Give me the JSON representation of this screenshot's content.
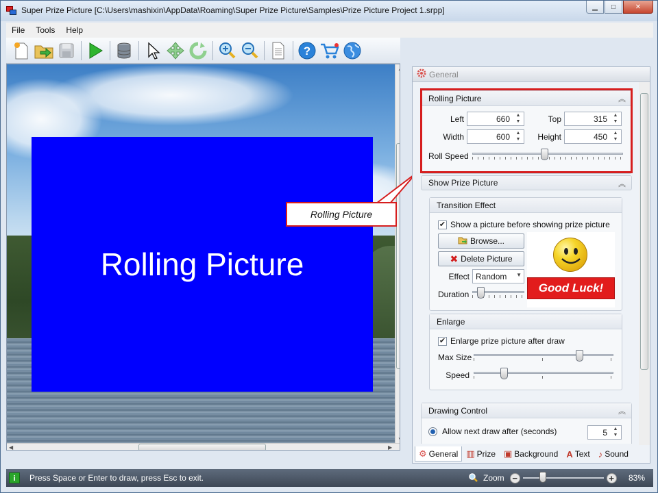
{
  "window": {
    "title": "Super Prize Picture [C:\\Users\\mashixin\\AppData\\Roaming\\Super Prize Picture\\Samples\\Prize Picture Project 1.srpp]",
    "minimize": "▁",
    "maximize": "□",
    "close": "✕"
  },
  "menu": [
    "File",
    "Tools",
    "Help"
  ],
  "toolbar": [
    {
      "name": "new-project-icon"
    },
    {
      "name": "open-folder-icon"
    },
    {
      "name": "save-disk-icon"
    },
    {
      "name": "play-icon"
    },
    {
      "name": "database-icon"
    },
    {
      "name": "pointer-icon"
    },
    {
      "name": "move-icon"
    },
    {
      "name": "rotate-icon"
    },
    {
      "name": "zoom-in-icon"
    },
    {
      "name": "zoom-out-icon"
    },
    {
      "name": "document-icon"
    },
    {
      "name": "help-icon"
    },
    {
      "name": "cart-icon"
    },
    {
      "name": "globe-icon"
    }
  ],
  "canvas": {
    "rolling_text": "Rolling Picture",
    "rolling_color": "#0000ff"
  },
  "callout": {
    "text": "Rolling Picture",
    "border_color": "#d61e1e"
  },
  "panel": {
    "header": "General",
    "rolling_picture": {
      "title": "Rolling Picture",
      "left_label": "Left",
      "left_value": "660",
      "top_label": "Top",
      "top_value": "315",
      "width_label": "Width",
      "width_value": "600",
      "height_label": "Height",
      "height_value": "450",
      "roll_speed_label": "Roll Speed",
      "roll_speed_level": 0.48
    },
    "show_prize": {
      "title": "Show Prize Picture",
      "transition": {
        "title": "Transition Effect",
        "show_before_label": "Show a picture before showing prize picture",
        "show_before_checked": true,
        "browse_label": "Browse...",
        "delete_label": "Delete Picture",
        "effect_label": "Effect",
        "effect_value": "Random",
        "duration_label": "Duration",
        "duration_level": 0.1,
        "preview_text": "Good Luck!"
      },
      "enlarge": {
        "title": "Enlarge",
        "enlarge_label": "Enlarge prize picture after draw",
        "enlarge_checked": true,
        "max_size_label": "Max Size",
        "max_size_level": 0.77,
        "speed_label": "Speed",
        "speed_level": 0.2
      }
    },
    "drawing_control": {
      "title": "Drawing Control",
      "allow_next_label": "Allow next draw after (seconds)",
      "allow_next_value": "5"
    },
    "tabs": [
      {
        "label": "General",
        "icon": "gear-icon",
        "active": true
      },
      {
        "label": "Prize",
        "icon": "book-icon",
        "active": false
      },
      {
        "label": "Background",
        "icon": "image-icon",
        "active": false
      },
      {
        "label": "Text",
        "icon": "text-icon",
        "active": false
      },
      {
        "label": "Sound",
        "icon": "music-note-icon",
        "active": false
      }
    ]
  },
  "status": {
    "message": "Press Space or Enter to draw, press Esc to exit.",
    "zoom_label": "Zoom",
    "zoom_value": "83%",
    "zoom_level": 0.25
  }
}
